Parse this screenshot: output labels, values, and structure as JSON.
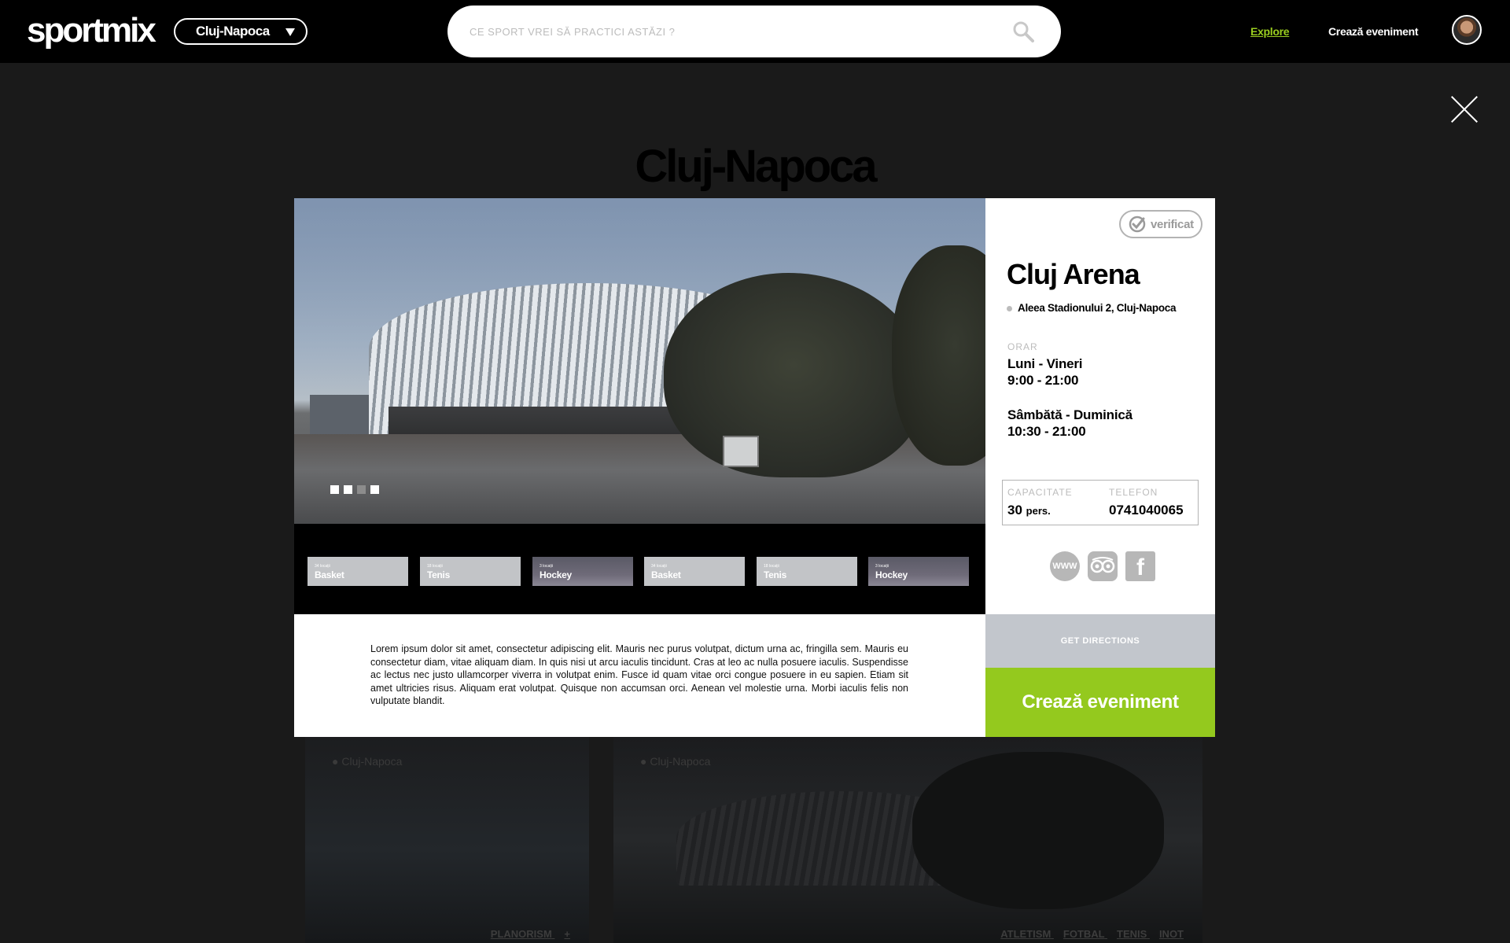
{
  "header": {
    "logo": "sportmix",
    "city": "Cluj-Napoca",
    "search_placeholder": "CE SPORT VREI SĂ PRACTICI ASTĂZI ?",
    "nav_explore": "Explore",
    "nav_create": "Crează eveniment"
  },
  "background": {
    "title": "Cluj-Napoca",
    "cards": [
      {
        "location": "● Cluj-Napoca",
        "tags": [
          "PLANORISM",
          "+"
        ]
      },
      {
        "location": "● Cluj-Napoca",
        "tags": [
          "ATLETISM",
          "FOTBAL",
          "TENIS",
          "INOT"
        ]
      }
    ]
  },
  "modal": {
    "courts": [
      {
        "count": "34 locații",
        "name": "Basket",
        "style": "light"
      },
      {
        "count": "18 locații",
        "name": "Tenis",
        "style": "light"
      },
      {
        "count": "3 locații",
        "name": "Hockey",
        "style": "dark"
      },
      {
        "count": "34 locații",
        "name": "Basket",
        "style": "light"
      },
      {
        "count": "18 locații",
        "name": "Tenis",
        "style": "light"
      },
      {
        "count": "3 locații",
        "name": "Hockey",
        "style": "dark"
      }
    ],
    "description": "Lorem ipsum dolor sit amet, consectetur adipiscing elit. Mauris nec purus volutpat, dictum urna ac, fringilla sem. Mauris eu consectetur diam, vitae aliquam diam. In quis nisi ut arcu iaculis tincidunt. Cras at leo ac nulla posuere iaculis. Suspendisse ac lectus nec justo ullamcorper viverra in volutpat enim. Fusce id quam vitae orci congue posuere in eu sapien. Etiam sit amet ultricies risus. Aliquam erat volutpat. Quisque non accumsan orci. Aenean vel molestie urna. Morbi iaculis felis non vulputate blandit.",
    "verified": "verificat",
    "venue_name": "Cluj Arena",
    "address": "Aleea Stadionului 2, Cluj-Napoca",
    "schedule_label": "ORAR",
    "schedule": [
      {
        "days": "Luni - Vineri",
        "hours": "9:00 - 21:00"
      },
      {
        "days": "Sâmbătă - Duminică",
        "hours": "10:30 - 21:00"
      }
    ],
    "capacity_label": "CAPACITATE",
    "capacity_value": "30",
    "capacity_unit": "pers.",
    "phone_label": "TELEFON",
    "phone_value": "0741040065",
    "socials": {
      "www": "WWW",
      "facebook": "f"
    },
    "directions": "GET DIRECTIONS",
    "create_button": "Crează eveniment"
  },
  "colors": {
    "accent_green": "#94c91e",
    "nav_active": "#9acd1f",
    "overlay_bg": "#1a1a1a"
  }
}
